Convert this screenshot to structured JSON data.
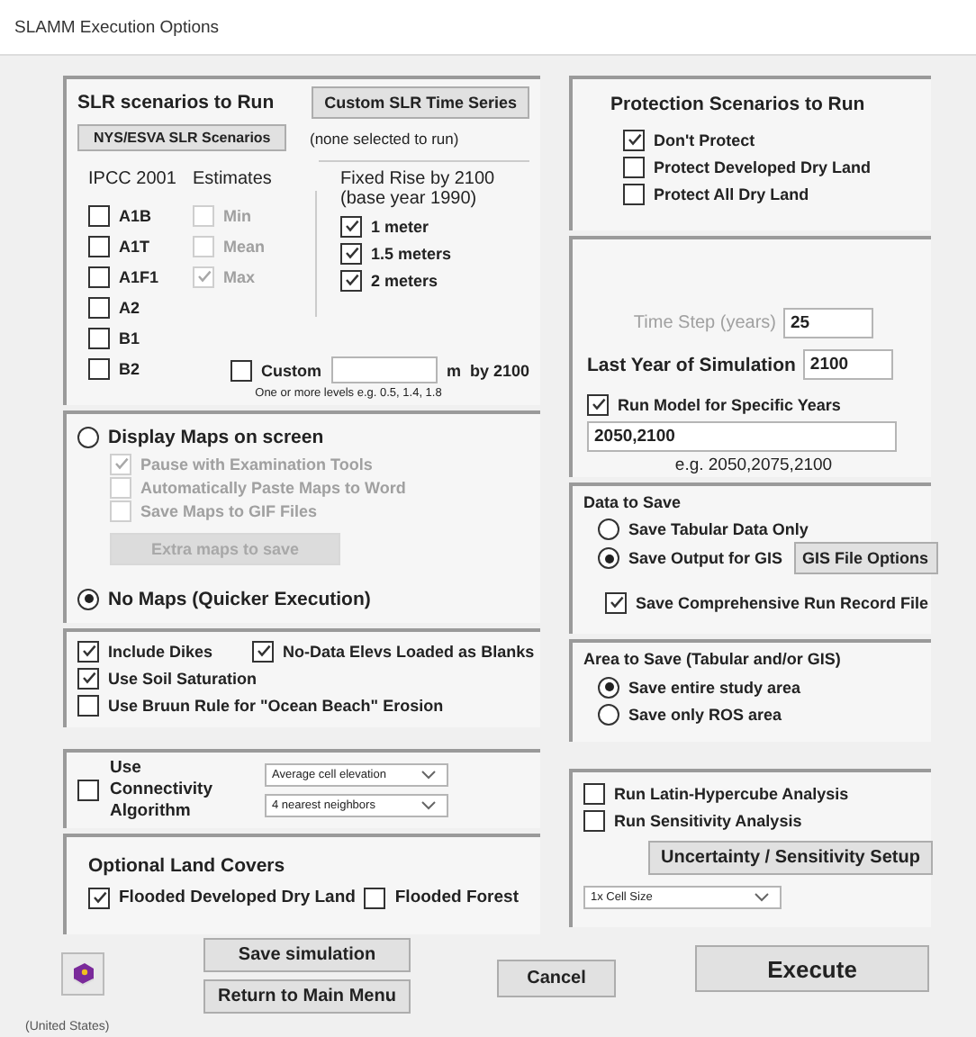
{
  "window": {
    "title": "SLAMM Execution Options"
  },
  "slr": {
    "heading": "SLR scenarios to Run",
    "custom_button": "Custom SLR Time Series",
    "nys_button": "NYS/ESVA SLR Scenarios",
    "custom_note": "(none selected to run)",
    "ipcc_heading": "IPCC 2001",
    "estimates_heading": "Estimates",
    "ipcc": [
      {
        "label": "A1B",
        "checked": false
      },
      {
        "label": "A1T",
        "checked": false
      },
      {
        "label": "A1F1",
        "checked": false
      },
      {
        "label": "A2",
        "checked": false
      },
      {
        "label": "B1",
        "checked": false
      },
      {
        "label": "B2",
        "checked": false
      }
    ],
    "estimates": [
      {
        "label": "Min",
        "checked": false,
        "disabled": true
      },
      {
        "label": "Mean",
        "checked": false,
        "disabled": true
      },
      {
        "label": "Max",
        "checked": true,
        "disabled": true
      }
    ],
    "fixed_heading": "Fixed Rise by 2100",
    "fixed_subheading": "(base year 1990)",
    "fixed": [
      {
        "label": "1 meter",
        "checked": true
      },
      {
        "label": "1.5 meters",
        "checked": true
      },
      {
        "label": "2 meters",
        "checked": true
      }
    ],
    "custom": {
      "label": "Custom",
      "checked": false,
      "unit": "m",
      "by": "by 2100",
      "hint": "One or more levels e.g. 0.5, 1.4, 1.8"
    }
  },
  "maps": {
    "options": [
      {
        "label": "Display Maps on screen",
        "selected": false
      },
      {
        "label": "No Maps (Quicker Execution)",
        "selected": true
      }
    ],
    "sub_options": [
      {
        "label": "Pause with Examination Tools",
        "checked": true,
        "disabled": true
      },
      {
        "label": "Automatically Paste Maps to Word",
        "checked": false,
        "disabled": true
      },
      {
        "label": "Save Maps to GIF Files",
        "checked": false,
        "disabled": true
      }
    ],
    "extra_button": {
      "label": "Extra maps to save",
      "disabled": true
    }
  },
  "model_options": [
    {
      "label": "Include Dikes",
      "checked": true
    },
    {
      "label": "No-Data Elevs Loaded as Blanks",
      "checked": true
    },
    {
      "label": "Use Soil Saturation",
      "checked": true
    },
    {
      "label": "Use Bruun Rule for \"Ocean Beach\" Erosion",
      "checked": false
    }
  ],
  "connectivity": {
    "label": "Use Connectivity Algorithm",
    "checked": false,
    "dropdowns": [
      "Average cell elevation",
      "4 nearest neighbors"
    ]
  },
  "land_covers": {
    "heading": "Optional Land Covers",
    "items": [
      {
        "label": "Flooded Developed Dry Land",
        "checked": true
      },
      {
        "label": "Flooded Forest",
        "checked": false
      }
    ]
  },
  "protection": {
    "heading": "Protection Scenarios to Run",
    "items": [
      {
        "label": "Don't Protect",
        "checked": true
      },
      {
        "label": "Protect Developed Dry Land",
        "checked": false
      },
      {
        "label": "Protect All Dry Land",
        "checked": false
      }
    ]
  },
  "timing": {
    "time_step_label": "Time Step (years)",
    "time_step_value": "25",
    "time_step_disabled": true,
    "last_year_label": "Last Year of Simulation",
    "last_year_value": "2100",
    "specific": {
      "label": "Run Model for Specific Years",
      "checked": true
    },
    "years_value": "2050,2100",
    "years_hint": "e.g. 2050,2075,2100"
  },
  "data_to_save": {
    "heading": "Data to Save",
    "options": [
      {
        "label": "Save Tabular Data Only",
        "selected": false
      },
      {
        "label": "Save Output for GIS",
        "selected": true
      }
    ],
    "gis_button": "GIS File Options",
    "record": {
      "label": "Save Comprehensive Run Record File",
      "checked": true
    }
  },
  "area": {
    "heading": "Area to Save (Tabular and/or GIS)",
    "options": [
      {
        "label": "Save entire study area",
        "selected": true
      },
      {
        "label": "Save only ROS area",
        "selected": false
      }
    ]
  },
  "analysis": {
    "items": [
      {
        "label": "Run Latin-Hypercube Analysis",
        "checked": false
      },
      {
        "label": "Run Sensitivity Analysis",
        "checked": false
      }
    ],
    "setup_button": "Uncertainty / Sensitivity Setup",
    "cell_size": "1x Cell Size"
  },
  "buttons": {
    "save": "Save simulation",
    "main_menu": "Return to Main Menu",
    "cancel": "Cancel",
    "execute": "Execute"
  },
  "status_bar": "(United States)"
}
